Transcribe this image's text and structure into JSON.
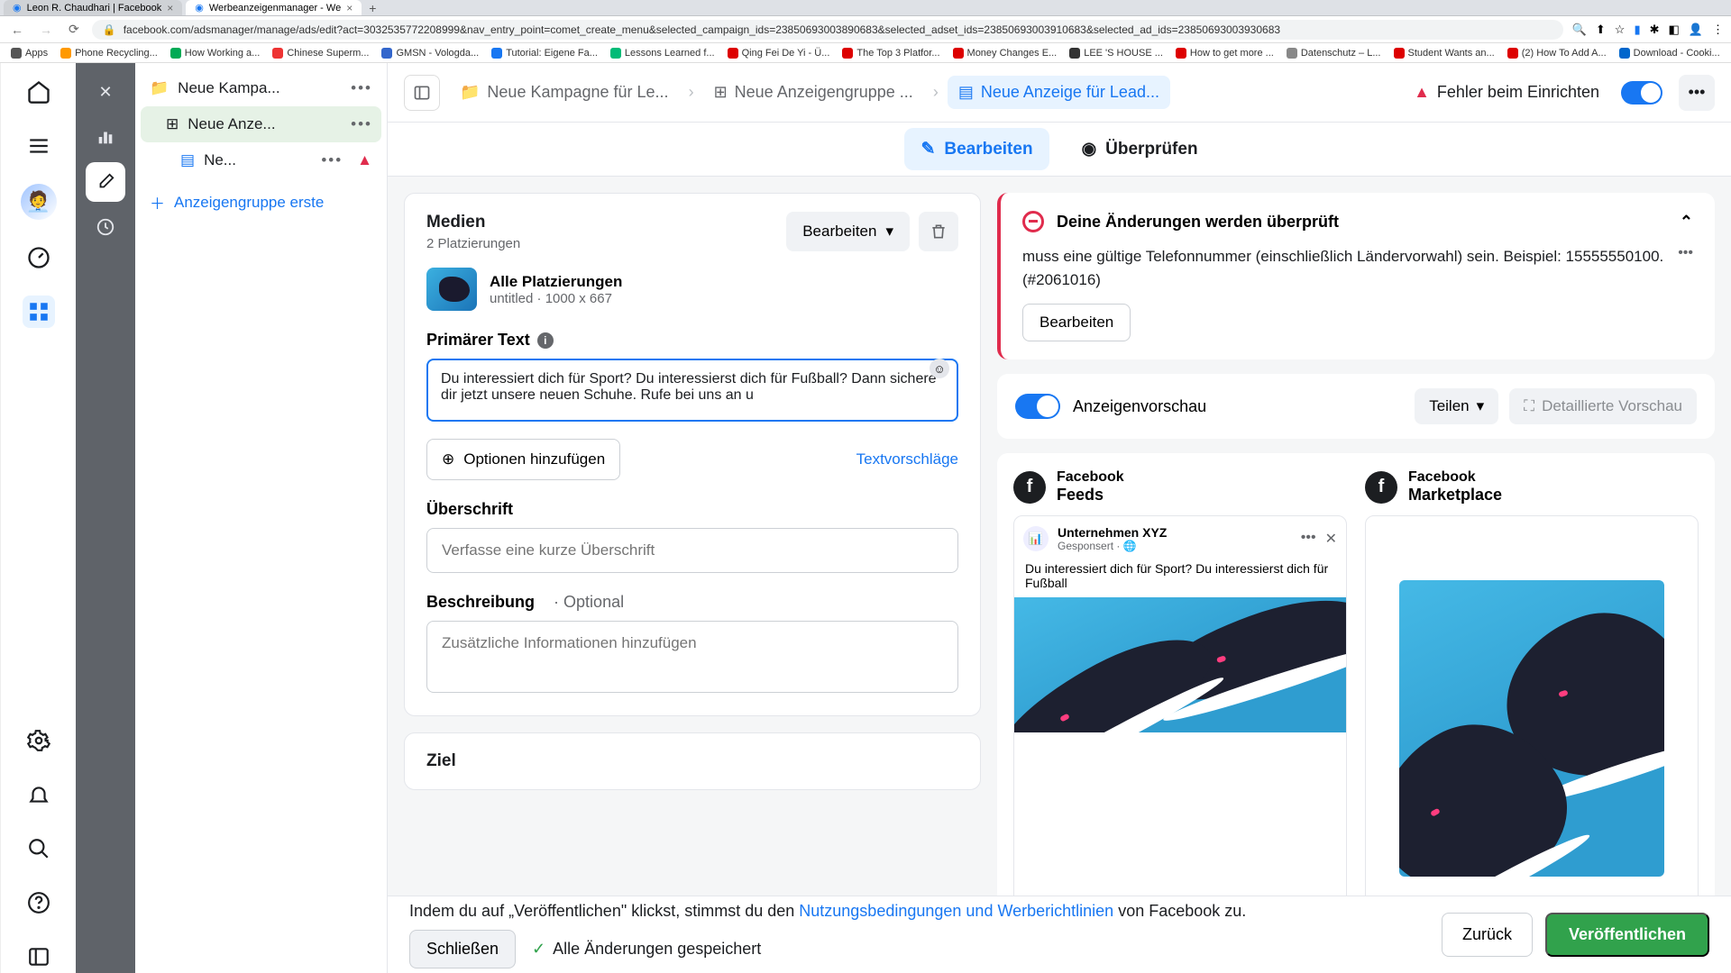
{
  "browser": {
    "tabs": [
      {
        "title": "Leon R. Chaudhari | Facebook"
      },
      {
        "title": "Werbeanzeigenmanager - We"
      }
    ],
    "url": "facebook.com/adsmanager/manage/ads/edit?act=3032535772208999&nav_entry_point=comet_create_menu&selected_campaign_ids=23850693003890683&selected_adset_ids=23850693003910683&selected_ad_ids=23850693003930683",
    "bookmarks": [
      "Apps",
      "Phone Recycling...",
      "How Working a...",
      "Chinese Superm...",
      "GMSN - Vologda...",
      "Tutorial: Eigene Fa...",
      "Lessons Learned f...",
      "Qing Fei De Yi - Ü...",
      "The Top 3 Platfor...",
      "Money Changes E...",
      "LEE 'S HOUSE ...",
      "How to get more ...",
      "Datenschutz – L...",
      "Student Wants an...",
      "(2) How To Add A...",
      "Download - Cooki..."
    ]
  },
  "tree": {
    "campaign": "Neue Kampa...",
    "adset": "Neue Anze...",
    "ad": "Ne...",
    "add_group": "Anzeigengruppe erste"
  },
  "breadcrumb": {
    "campaign": "Neue Kampagne für Le...",
    "adset": "Neue Anzeigengruppe ...",
    "ad": "Neue Anzeige für Lead...",
    "status": "Fehler beim Einrichten"
  },
  "tabs": {
    "edit": "Bearbeiten",
    "review": "Überprüfen"
  },
  "form": {
    "media_title": "Medien",
    "media_sub": "2 Platzierungen",
    "edit_btn": "Bearbeiten",
    "placement_title": "Alle Platzierungen",
    "placement_sub": "untitled · 1000 x 667",
    "primary_label": "Primärer Text",
    "primary_text": "Du interessiert dich für Sport? Du interessierst dich für Fußball? Dann sichere dir jetzt unsere neuen Schuhe. Rufe bei uns an u",
    "options_btn": "Optionen hinzufügen",
    "suggest_link": "Textvorschläge",
    "headline_label": "Überschrift",
    "headline_ph": "Verfasse eine kurze Überschrift",
    "desc_label": "Beschreibung",
    "optional": "· Optional",
    "desc_ph": "Zusätzliche Informationen hinzufügen",
    "ziel_label": "Ziel"
  },
  "warning": {
    "title": "Deine Änderungen werden überprüft",
    "body": "muss eine gültige Telefonnummer (einschließlich Ländervorwahl) sein. Beispiel: 15555550100. (#2061016)",
    "btn": "Bearbeiten"
  },
  "preview": {
    "title": "Anzeigenvorschau",
    "share": "Teilen",
    "detailed": "Detaillierte Vorschau",
    "col1_top": "Facebook",
    "col1_bot": "Feeds",
    "col2_top": "Facebook",
    "col2_bot": "Marketplace",
    "mock_company": "Unternehmen XYZ",
    "mock_spons": "Gesponsert · 🌐",
    "mock_text": "Du interessiert dich für Sport? Du interessierst dich für Fußball"
  },
  "footer": {
    "msg_pre": "Indem du auf „Veröffentlichen\" klickst, stimmst du den ",
    "msg_link": "Nutzungsbedingungen und Werberichtlinien",
    "msg_post": " von Facebook zu.",
    "close": "Schließen",
    "saved": "Alle Änderungen gespeichert",
    "back": "Zurück",
    "publish": "Veröffentlichen"
  }
}
